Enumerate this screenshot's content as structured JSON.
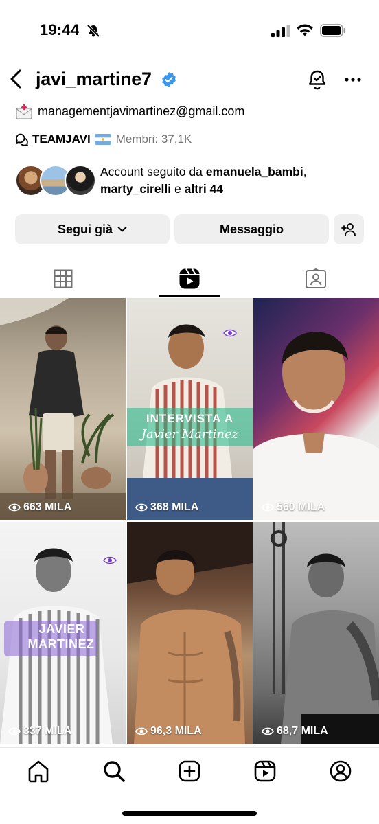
{
  "status_bar": {
    "time": "19:44"
  },
  "header": {
    "username": "javi_martine7"
  },
  "bio": {
    "email": "managementjavimartinez@gmail.com",
    "team_name": "TEAMJAVI",
    "members": "Membri: 37,1K"
  },
  "followed_by": {
    "prefix": "Account seguito da ",
    "user1": "emanuela_bambi",
    "sep1": ",",
    "user2": "marty_cirelli",
    "sep2": " e ",
    "others": "altri 44"
  },
  "actions": {
    "follow_label": "Segui già",
    "message_label": "Messaggio"
  },
  "tabs": [
    "grid",
    "reels",
    "tagged"
  ],
  "active_tab": "reels",
  "reels": [
    {
      "views": "663 MILA"
    },
    {
      "views": "368 MILA",
      "overlay_line1": "INTERVISTA A",
      "overlay_line2": "Javier Martinez"
    },
    {
      "views": "560 MILA"
    },
    {
      "views": "337 MILA",
      "overlay_line1": "JAVIER",
      "overlay_line2": "MARTINEZ"
    },
    {
      "views": "96,3 MILA"
    },
    {
      "views": "68,7 MILA"
    }
  ],
  "colors": {
    "verified_blue": "#3897f0",
    "button_bg": "#efefef",
    "secondary_text": "#737373"
  },
  "icons": {
    "bottom_nav": [
      "home-icon",
      "search-icon",
      "create-icon",
      "reels-icon",
      "profile-icon"
    ]
  }
}
